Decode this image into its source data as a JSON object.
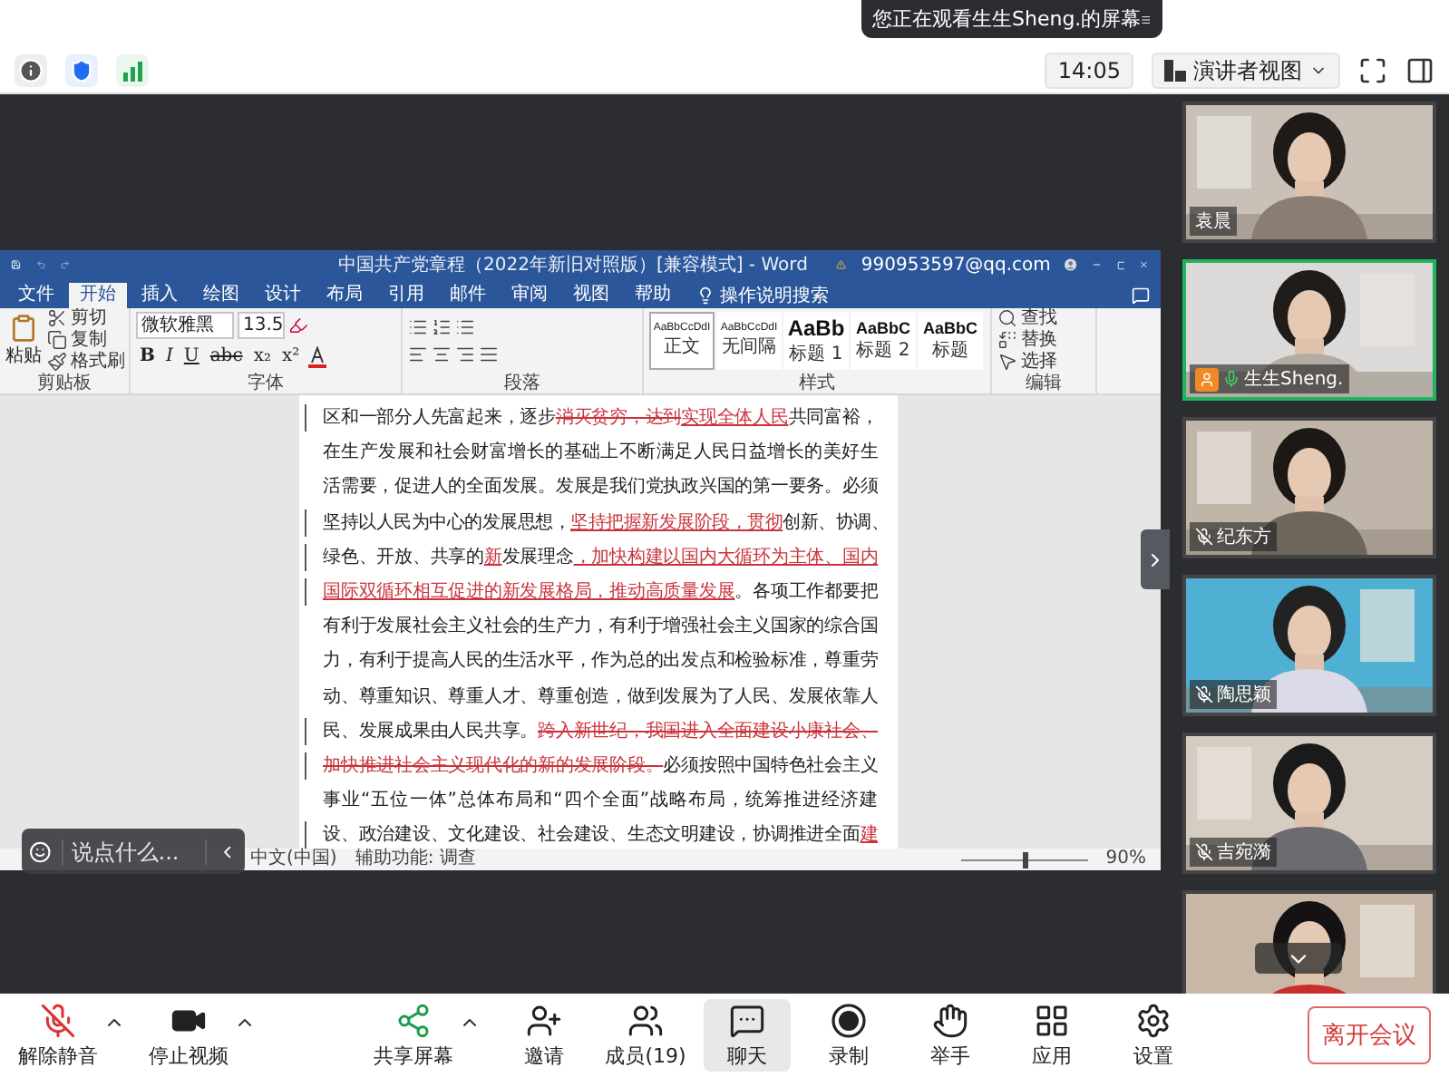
{
  "toast": {
    "text": "您正在观看生生Sheng.的屏幕"
  },
  "top_bar": {
    "time": "14:05",
    "view_menu": "演讲者视图"
  },
  "word": {
    "title": "中国共产党章程（2022年新旧对照版）[兼容模式] - Word",
    "account": "990953597@qq.com",
    "tabs": [
      {
        "label": "文件",
        "selected": false
      },
      {
        "label": "开始",
        "selected": true
      },
      {
        "label": "插入",
        "selected": false
      },
      {
        "label": "绘图",
        "selected": false
      },
      {
        "label": "设计",
        "selected": false
      },
      {
        "label": "布局",
        "selected": false
      },
      {
        "label": "引用",
        "selected": false
      },
      {
        "label": "邮件",
        "selected": false
      },
      {
        "label": "审阅",
        "selected": false
      },
      {
        "label": "视图",
        "selected": false
      },
      {
        "label": "帮助",
        "selected": false
      }
    ],
    "tell_me": "操作说明搜索",
    "clipboard": {
      "paste": "粘贴",
      "items": [
        "剪切",
        "复制",
        "格式刷"
      ],
      "label": "剪贴板"
    },
    "font": {
      "name": "微软雅黑",
      "size": "13.5",
      "buttons": [
        "B",
        "I",
        "U",
        "abc",
        "x₂",
        "x²"
      ],
      "label": "字体"
    },
    "paragraph": {
      "label": "段落"
    },
    "styles": {
      "label": "样式",
      "items": [
        {
          "sample": "AaBbCcDdI",
          "name": "正文",
          "selected": true,
          "kind": "body"
        },
        {
          "sample": "AaBbCcDdI",
          "name": "无间隔",
          "selected": false,
          "kind": "body"
        },
        {
          "sample": "AaBb",
          "name": "标题 1",
          "selected": false,
          "kind": "heading1"
        },
        {
          "sample": "AaBbC",
          "name": "标题 2",
          "selected": false,
          "kind": "heading2"
        },
        {
          "sample": "AaBbC",
          "name": "标题",
          "selected": false,
          "kind": "heading2"
        }
      ]
    },
    "editing": {
      "label": "编辑",
      "items": [
        "查找",
        "替换",
        "选择"
      ]
    },
    "document": {
      "lines": [
        [
          {
            "text": "区和一部分人先富起来，逐步",
            "kind": "normal"
          },
          {
            "text": "消灭贫穷，达到",
            "kind": "delete"
          },
          {
            "text": "实现全体人民",
            "kind": "insert"
          },
          {
            "text": "共同富裕，",
            "kind": "normal"
          }
        ],
        [
          {
            "text": "在生产发展和社会财富增长的基础上不断满足人民日益增长的美好生",
            "kind": "normal"
          }
        ],
        [
          {
            "text": "活需要，促进人的全面发展。发展是我们党执政兴国的第一要务。必须",
            "kind": "normal"
          }
        ],
        [
          {
            "text": "坚持以人民为中心的发展思想，",
            "kind": "normal"
          },
          {
            "text": "坚持把握新发展阶段，贯彻",
            "kind": "insert"
          },
          {
            "text": "创新、协调、",
            "kind": "normal"
          }
        ],
        [
          {
            "text": "绿色、开放、共享的",
            "kind": "normal"
          },
          {
            "text": "新",
            "kind": "insert"
          },
          {
            "text": "发展理念",
            "kind": "normal"
          },
          {
            "text": "，加快构建以国内大循环为主体、国内",
            "kind": "insert"
          }
        ],
        [
          {
            "text": "国际双循环相互促进的新发展格局，推动高质量发展",
            "kind": "insert"
          },
          {
            "text": "。各项工作都要把",
            "kind": "normal"
          }
        ],
        [
          {
            "text": "有利于发展社会主义社会的生产力，有利于增强社会主义国家的综合国",
            "kind": "normal"
          }
        ],
        [
          {
            "text": "力，有利于提高人民的生活水平，作为总的出发点和检验标准，尊重劳",
            "kind": "normal"
          }
        ],
        [
          {
            "text": "动、尊重知识、尊重人才、尊重创造，做到发展为了人民、发展依靠人",
            "kind": "normal"
          }
        ],
        [
          {
            "text": "民、发展成果由人民共享。",
            "kind": "normal"
          },
          {
            "text": "跨入新世纪，我国进入全面建设小康社会、",
            "kind": "delete"
          }
        ],
        [
          {
            "text": "加快推进社会主义现代化的新的发展阶段。",
            "kind": "delete"
          },
          {
            "text": "必须按照中国特色社会主义",
            "kind": "normal"
          }
        ],
        [
          {
            "text": "事业“五位一体”总体布局和“四个全面”战略布局，统筹推进经济建",
            "kind": "normal"
          }
        ],
        [
          {
            "text": "设、政治建设、文化建设、社会建设、生态文明建设，协调推进全面",
            "kind": "normal"
          },
          {
            "text": "建",
            "kind": "insert"
          }
        ]
      ]
    },
    "status": {
      "language": "中文(中国)",
      "accessibility": "辅助功能: 调查",
      "zoom": "90%",
      "level": 0.5
    }
  },
  "chat_input": {
    "placeholder": "说点什么..."
  },
  "participants": [
    {
      "name": "袁晨",
      "speaking": false,
      "host": false
    },
    {
      "name": "生生Sheng.",
      "speaking": true,
      "host": true,
      "muted": false
    },
    {
      "name": "纪东方",
      "speaking": false,
      "host": false,
      "muted": true
    },
    {
      "name": "陶思颖",
      "speaking": false,
      "host": false,
      "muted": true
    },
    {
      "name": "吉宛漪",
      "speaking": false,
      "host": false,
      "muted": true
    },
    {
      "speaking": false
    }
  ],
  "toolbar": [
    {
      "label": "解除静音",
      "kind": "mic_muted",
      "menu": true,
      "selected": false
    },
    {
      "label": "停止视频",
      "kind": "video",
      "menu": true,
      "selected": false
    },
    {
      "label": "共享屏幕",
      "kind": "share",
      "menu": true,
      "selected": false
    },
    {
      "label": "邀请",
      "kind": "invite",
      "menu": false,
      "selected": false
    },
    {
      "label": "成员(19)",
      "kind": "members",
      "menu": false,
      "selected": false
    },
    {
      "label": "聊天",
      "kind": "chat",
      "menu": false,
      "selected": true
    },
    {
      "label": "录制",
      "kind": "record",
      "menu": false,
      "selected": false
    },
    {
      "label": "举手",
      "kind": "hand",
      "menu": false,
      "selected": false
    },
    {
      "label": "应用",
      "kind": "apps",
      "menu": false,
      "selected": false
    },
    {
      "label": "设置",
      "kind": "settings",
      "menu": false,
      "selected": false
    }
  ],
  "leave_button": "离开会议"
}
